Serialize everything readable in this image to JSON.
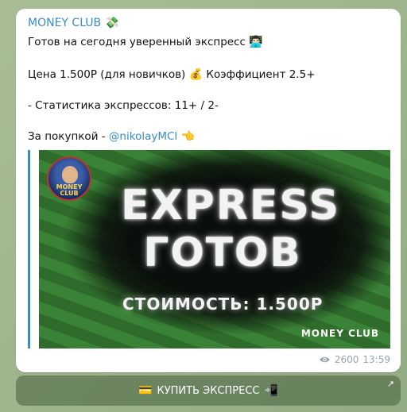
{
  "message": {
    "sender": "MONEY CLUB",
    "sender_emoji": "💸",
    "line1": "Готов на сегодня уверенный экспресс",
    "line1_emoji": "👨🏻‍💻",
    "line2_a": "Цена 1.500Р (для новичков)",
    "line2_emoji": "💰",
    "line2_b": "Коэффициент 2.5+",
    "line3": "- Статистика экспрессов: 11+ / 2-",
    "line4_a": "За покупкой - ",
    "line4_mention": "@nikolayMCl",
    "line4_emoji": "👈",
    "views": "2600",
    "time": "13:59"
  },
  "banner": {
    "title_1": "EXPRESS",
    "title_2": "ГОТОВ",
    "price": "СТОИМОСТЬ: 1.500Р",
    "brand": "MONEY CLUB",
    "logo_text_1": "MONEY",
    "logo_text_2": "CLUB"
  },
  "button": {
    "label": "КУПИТЬ ЭКСПРЕСС",
    "left_emoji": "💳",
    "right_emoji": "📲"
  },
  "colors": {
    "link": "#3a8bc9",
    "bubble": "#ffffff",
    "banner_green": "#2e6b2b"
  }
}
